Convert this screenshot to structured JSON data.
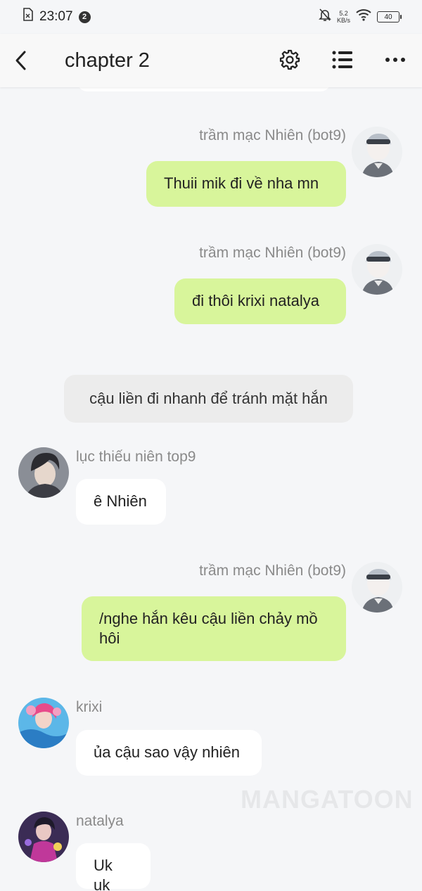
{
  "status_bar": {
    "time": "23:07",
    "notification_count": "2",
    "net_speed_value": "5.2",
    "net_speed_unit": "KB/s",
    "battery": "40"
  },
  "header": {
    "title": "chapter 2"
  },
  "messages": [
    {
      "sender": "trầm mạc Nhiên (bot9)",
      "text": "Thuii mik đi về nha mn",
      "side": "right"
    },
    {
      "sender": "trầm mạc Nhiên (bot9)",
      "text": "đi thôi krixi natalya",
      "side": "right"
    },
    {
      "narration": "cậu liền đi nhanh để tránh mặt hắn"
    },
    {
      "sender": "lục thiếu niên top9",
      "text": "ê Nhiên",
      "side": "left"
    },
    {
      "sender": "trầm mạc Nhiên (bot9)",
      "text": "/nghe hắn kêu cậu liền chảy mồ hôi",
      "side": "right"
    },
    {
      "sender": "krixi",
      "text": "ủa cậu sao vậy nhiên",
      "side": "left"
    },
    {
      "sender": "natalya",
      "text": "Uk uk",
      "side": "left"
    }
  ],
  "watermark": "MANGATOON",
  "colors": {
    "outgoing_bubble": "#d8f59b",
    "incoming_bubble": "#ffffff",
    "narration_bubble": "#ececec",
    "background": "#f5f6f8"
  }
}
